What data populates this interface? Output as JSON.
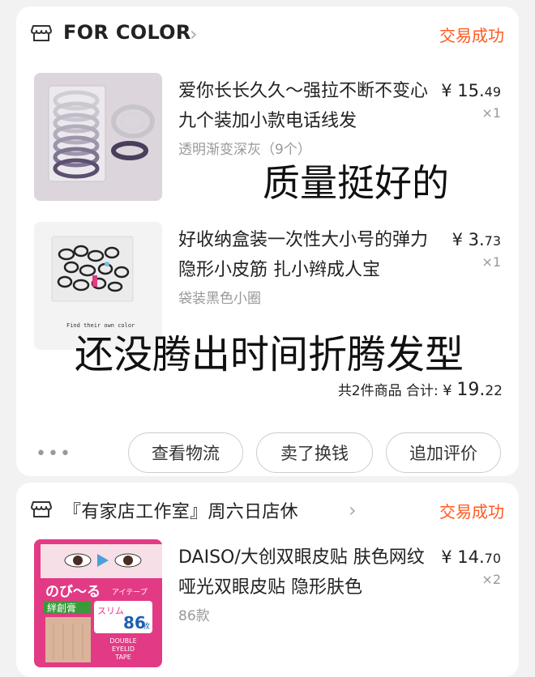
{
  "orders": [
    {
      "shop_name": "FOR COLOR",
      "status": "交易成功",
      "items": [
        {
          "title": "爱你长长久久～强拉不断不变心 九个装加小款电话线发",
          "variant": "透明渐变深灰（9个）",
          "price_int": "¥ 15.",
          "price_dec": "49",
          "qty": "×1"
        },
        {
          "title": "好收纳盒装一次性大小号的弹力隐形小皮筋 扎小辫成人宝",
          "variant": "袋装黑色小圈",
          "price_int": "¥ 3.",
          "price_dec": "73",
          "qty": "×1",
          "thumb_caption": "Find their own color"
        }
      ],
      "summary_count": "共2件商品 合计:",
      "summary_currency": "¥ ",
      "summary_int": "19.",
      "summary_dec": "22",
      "more": "•••",
      "buttons": [
        "查看物流",
        "卖了换钱",
        "追加评价"
      ]
    },
    {
      "shop_name": "『有家店工作室』周六日店休",
      "status": "交易成功",
      "items": [
        {
          "title": "DAISO/大创双眼皮贴 肤色网纹哑光双眼皮贴 隐形肤色",
          "variant": "86款",
          "price_int": "¥ 14.",
          "price_dec": "70",
          "qty": "×2",
          "thumb_text": {
            "logo": "のび〜る",
            "sub": "アイテープ",
            "brand": "絆創膏",
            "type": "スリム",
            "count": "86",
            "count_unit": "枚",
            "bottom1": "DOUBLE",
            "bottom2": "EYELID",
            "bottom3": "TAPE"
          }
        }
      ]
    }
  ],
  "overlay_texts": {
    "comment1": "质量挺好的",
    "comment2": "还没腾出时间折腾发型"
  },
  "colors": {
    "accent": "#ff5a1f",
    "package_pink": "#e23a84"
  }
}
